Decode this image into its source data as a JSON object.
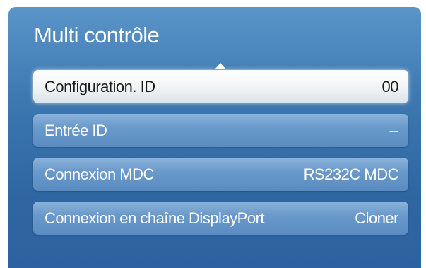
{
  "osd": {
    "title": "Multi contrôle",
    "scroll_indicator_icon": "up-arrow-icon",
    "items": [
      {
        "label": "Configuration. ID",
        "value": "00",
        "selected": true
      },
      {
        "label": "Entrée ID",
        "value": "--",
        "selected": false
      },
      {
        "label": "Connexion MDC",
        "value": "RS232C MDC",
        "selected": false
      },
      {
        "label": "Connexion en chaîne DisplayPort",
        "value": "Cloner",
        "selected": false
      }
    ]
  },
  "colors": {
    "panel": "#3d78b1",
    "item": "#6a9acb",
    "selected_item": "#ffffff"
  }
}
